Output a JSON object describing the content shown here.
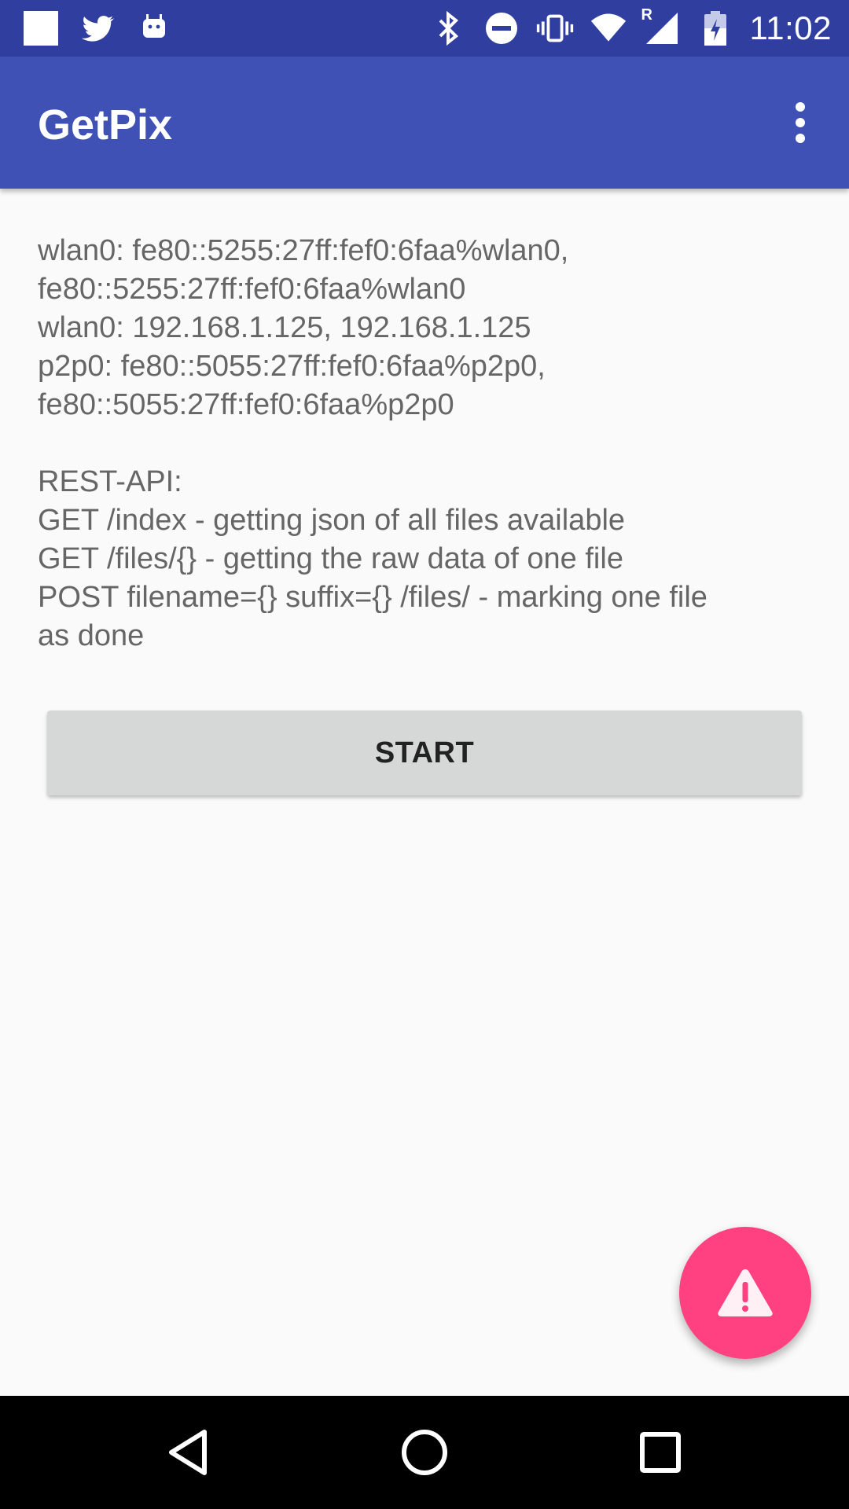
{
  "status_bar": {
    "time": "11:02",
    "left_icons": [
      "square-notification-icon",
      "twitter-icon",
      "android-icon"
    ],
    "right_icons": [
      "bluetooth-icon",
      "do-not-disturb-icon",
      "vibrate-icon",
      "wifi-icon",
      "signal-icon",
      "battery-icon"
    ],
    "signal_roaming_label": "R"
  },
  "app_bar": {
    "title": "GetPix",
    "overflow_icon": "more-vert-icon"
  },
  "info": {
    "lines": [
      "wlan0: fe80::5255:27ff:fef0:6faa%wlan0,",
      "fe80::5255:27ff:fef0:6faa%wlan0",
      "wlan0: 192.168.1.125, 192.168.1.125",
      "p2p0: fe80::5055:27ff:fef0:6faa%p2p0,",
      "fe80::5055:27ff:fef0:6faa%p2p0"
    ],
    "api_lines": [
      "REST-API:",
      "GET /index - getting json of all files available",
      "GET /files/{} - getting the raw data of one file",
      "POST filename={} suffix={} /files/ - marking one file",
      "as done"
    ]
  },
  "start_button": {
    "label": "START"
  },
  "fab": {
    "icon": "warning-icon"
  },
  "nav_bar": {
    "icons": [
      "back-icon",
      "home-icon",
      "recents-icon"
    ]
  },
  "colors": {
    "status_bar": "#303f9f",
    "app_bar": "#3f51b5",
    "fab": "#ff4081",
    "button": "#d6d7d7",
    "background": "#fafafa"
  }
}
